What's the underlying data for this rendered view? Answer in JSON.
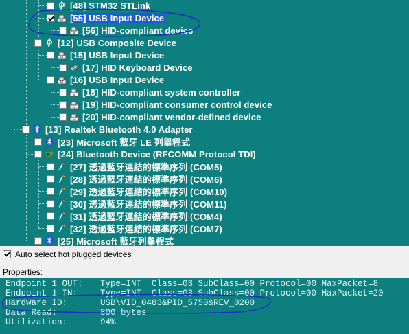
{
  "tree": {
    "nodes": [
      {
        "label": "[48] STM32 STLink",
        "checked": false,
        "selected": false,
        "icon": "usb-icon",
        "level": 3
      },
      {
        "label": "[55] USB Input Device",
        "checked": true,
        "selected": true,
        "icon": "hid-device-icon",
        "level": 3
      },
      {
        "label": "[56] HID-compliant device",
        "checked": false,
        "selected": false,
        "icon": "hid-device-icon",
        "level": 4
      },
      {
        "label": "[12] USB Composite Device",
        "checked": false,
        "selected": false,
        "icon": "usb-icon",
        "level": 2
      },
      {
        "label": "[15] USB Input Device",
        "checked": false,
        "selected": false,
        "icon": "hid-device-icon",
        "level": 3
      },
      {
        "label": "[17] HID Keyboard Device",
        "checked": false,
        "selected": false,
        "icon": "keyboard-icon",
        "level": 4
      },
      {
        "label": "[16] USB Input Device",
        "checked": false,
        "selected": false,
        "icon": "hid-device-icon",
        "level": 3
      },
      {
        "label": "[18] HID-compliant system controller",
        "checked": false,
        "selected": false,
        "icon": "hid-device-icon",
        "level": 4
      },
      {
        "label": "[19] HID-compliant consumer control device",
        "checked": false,
        "selected": false,
        "icon": "hid-device-icon",
        "level": 4
      },
      {
        "label": "[20] HID-compliant vendor-defined device",
        "checked": false,
        "selected": false,
        "icon": "hid-device-icon",
        "level": 4
      },
      {
        "label": "[13] Realtek Bluetooth 4.0 Adapter",
        "checked": false,
        "selected": false,
        "icon": "bluetooth-icon",
        "level": 1
      },
      {
        "label": "[23] Microsoft 藍牙 LE 列舉程式",
        "checked": false,
        "selected": false,
        "icon": "bluetooth-icon",
        "level": 2
      },
      {
        "label": "[24] Bluetooth Device (RFCOMM Protocol TDI)",
        "checked": false,
        "selected": false,
        "icon": "network-card-icon",
        "level": 2
      },
      {
        "label": "[27] 透過藍牙連結的標準序列 (COM5)",
        "checked": false,
        "selected": false,
        "icon": "serial-port-icon",
        "level": 3
      },
      {
        "label": "[28] 透過藍牙連結的標準序列 (COM6)",
        "checked": false,
        "selected": false,
        "icon": "serial-port-icon",
        "level": 3
      },
      {
        "label": "[29] 透過藍牙連結的標準序列 (COM10)",
        "checked": false,
        "selected": false,
        "icon": "serial-port-icon",
        "level": 3
      },
      {
        "label": "[30] 透過藍牙連結的標準序列 (COM11)",
        "checked": false,
        "selected": false,
        "icon": "serial-port-icon",
        "level": 3
      },
      {
        "label": "[31] 透過藍牙連結的標準序列 (COM4)",
        "checked": false,
        "selected": false,
        "icon": "serial-port-icon",
        "level": 3
      },
      {
        "label": "[32] 透過藍牙連結的標準序列 (COM7)",
        "checked": false,
        "selected": false,
        "icon": "serial-port-icon",
        "level": 3
      },
      {
        "label": "[25] Microsoft 藍牙列舉程式",
        "checked": false,
        "selected": false,
        "icon": "bluetooth-icon",
        "level": 2
      }
    ]
  },
  "auto_select": {
    "label": "Auto select hot plugged devices",
    "checked": true
  },
  "properties": {
    "label": "Properties:",
    "lines": [
      {
        "key": "Endpoint 1 OUT:",
        "value": "Type=INT  Class=03 SubClass=00 Protocol=00 MaxPacket=8"
      },
      {
        "key": "Endpoint 1 IN:",
        "value": "Type=INT  Class=03 SubClass=00 Protocol=00 MaxPacket=20"
      },
      {
        "key": "Hardware ID:",
        "value": "USB\\VID_0483&PID_5750&REV_0200"
      },
      {
        "key": "Data Read:",
        "value": "800 bytes"
      },
      {
        "key": "Utilization:",
        "value": "94%"
      }
    ]
  },
  "colors": {
    "background": "#0e7f7f",
    "selection": "#1c5bd6",
    "annotation": "#1a2dc8"
  }
}
